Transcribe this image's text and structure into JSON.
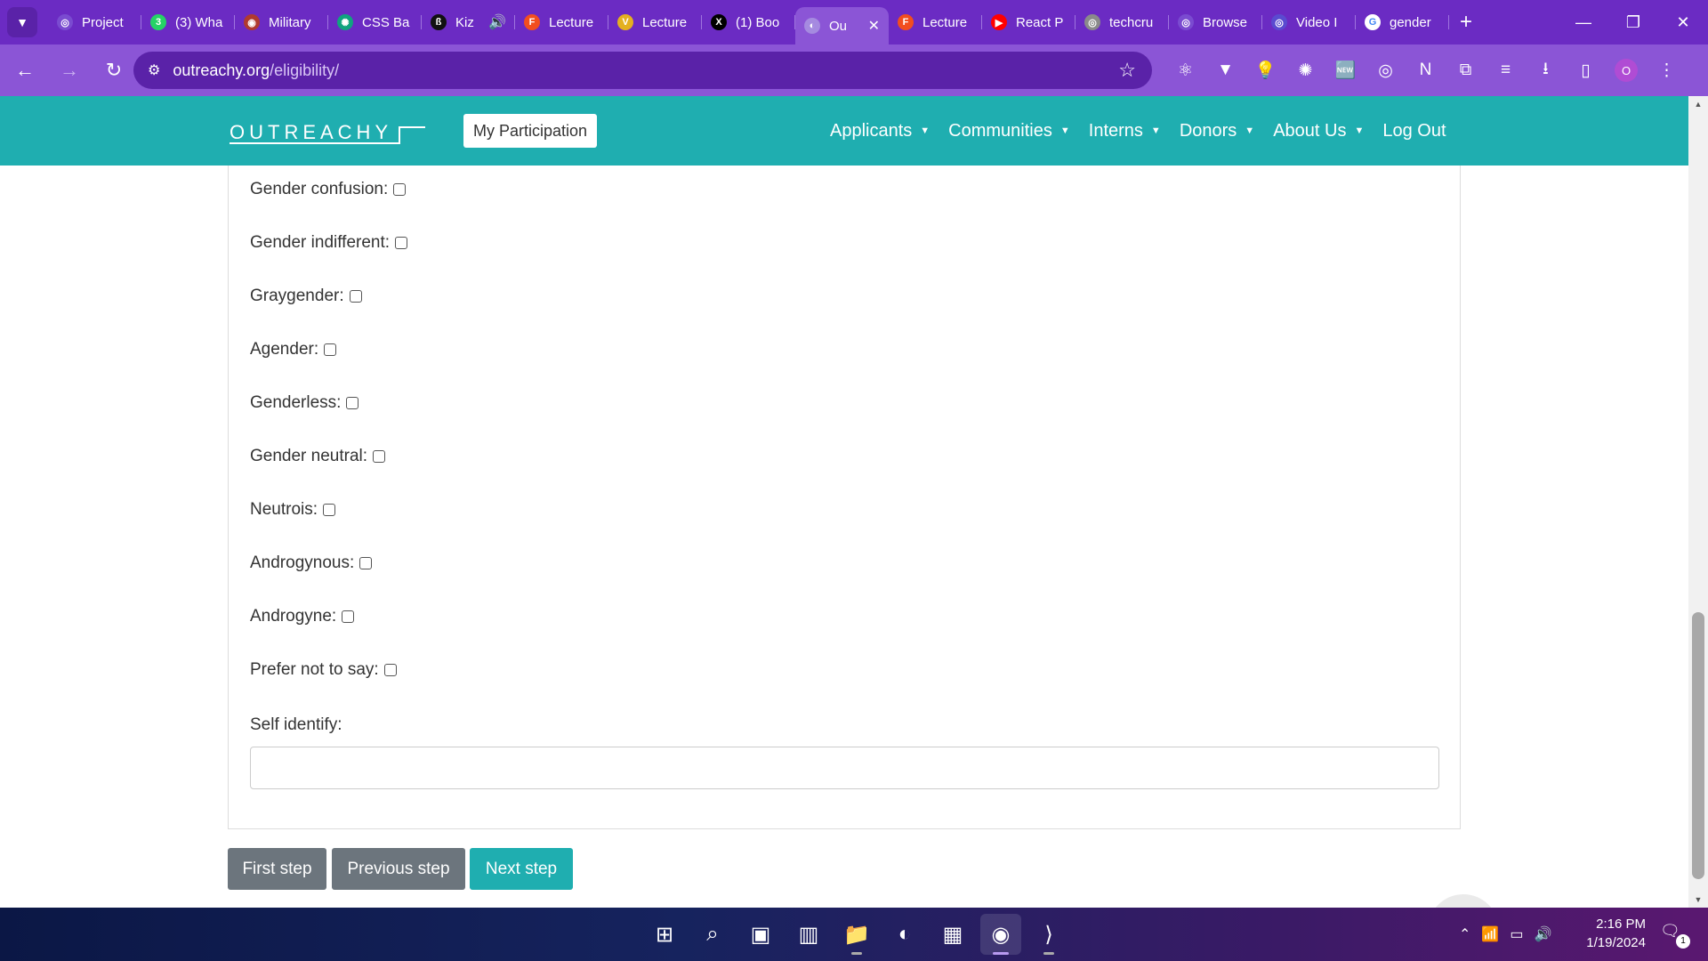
{
  "browser": {
    "tabs": [
      {
        "title": "Project",
        "favicon_color": "#7a4bd0",
        "favicon_glyph": "◎"
      },
      {
        "title": "(3) Wha",
        "favicon_color": "#25d366",
        "favicon_glyph": "3"
      },
      {
        "title": "Military",
        "favicon_color": "#b03a2e",
        "favicon_glyph": "◉"
      },
      {
        "title": "CSS Ba",
        "favicon_color": "#10a37f",
        "favicon_glyph": "✺"
      },
      {
        "title": "Kiz",
        "favicon_color": "#111111",
        "favicon_glyph": "ß",
        "audio": "🔊"
      },
      {
        "title": "Lecture",
        "favicon_color": "#f24e1e",
        "favicon_glyph": "F"
      },
      {
        "title": "Lecture",
        "favicon_color": "#e4b020",
        "favicon_glyph": "V"
      },
      {
        "title": "(1) Boo",
        "favicon_color": "#000000",
        "favicon_glyph": "X"
      },
      {
        "title": "Ou",
        "favicon_color": "#a58ae0",
        "favicon_glyph": "◐",
        "active": true
      },
      {
        "title": "Lecture",
        "favicon_color": "#f24e1e",
        "favicon_glyph": "F"
      },
      {
        "title": "React P",
        "favicon_color": "#ff0000",
        "favicon_glyph": "▶"
      },
      {
        "title": "techcru",
        "favicon_color": "#8a8a8a",
        "favicon_glyph": "◎"
      },
      {
        "title": "Browse",
        "favicon_color": "#7a4bd0",
        "favicon_glyph": "◎"
      },
      {
        "title": "Video I",
        "favicon_color": "#5a4bd0",
        "favicon_glyph": "◎"
      },
      {
        "title": "gender",
        "favicon_color": "#ffffff",
        "favicon_glyph": "G"
      }
    ],
    "close_tab": "✕",
    "new_tab": "+",
    "window": {
      "minimize": "—",
      "restore": "❐",
      "close": "✕"
    },
    "nav": {
      "back": "←",
      "forward": "→",
      "reload": "↻"
    },
    "url_host": "outreachy.org",
    "url_path": "/eligibility/",
    "bookmark": "☆",
    "extensions": [
      "⚛",
      "▼",
      "💡",
      "✺",
      "🆕",
      "◎",
      "N",
      "⧉",
      "≡",
      "⭳",
      "▯"
    ],
    "profile_initial": "O"
  },
  "site": {
    "logo": "OUTREACHY",
    "my_participation": "My Participation",
    "menu": [
      "Applicants",
      "Communities",
      "Interns",
      "Donors",
      "About Us"
    ],
    "logout": "Log Out",
    "caret": "▼"
  },
  "form": {
    "options": [
      "Gender confusion:",
      "Gender indifferent:",
      "Graygender:",
      "Agender:",
      "Genderless:",
      "Gender neutral:",
      "Neutrois:",
      "Androgynous:",
      "Androgyne:",
      "Prefer not to say:"
    ],
    "self_identify_label": "Self identify:",
    "self_identify_value": ""
  },
  "buttons": {
    "first": "First step",
    "previous": "Previous step",
    "next": "Next step"
  },
  "colors": {
    "brand_teal": "#1faeb0",
    "browser_purple": "#8b55d6",
    "button_grey": "#6c757d"
  },
  "taskbar": {
    "apps": [
      "⊞",
      "⌕",
      "▣",
      "▥",
      "📁",
      "◐",
      "▦",
      "◉",
      "⟩"
    ],
    "tray": [
      "⌃",
      "📶",
      "▭",
      "🔊"
    ],
    "time": "2:16 PM",
    "date": "1/19/2024",
    "notif_icon": "🗨",
    "notif_count": "1"
  }
}
